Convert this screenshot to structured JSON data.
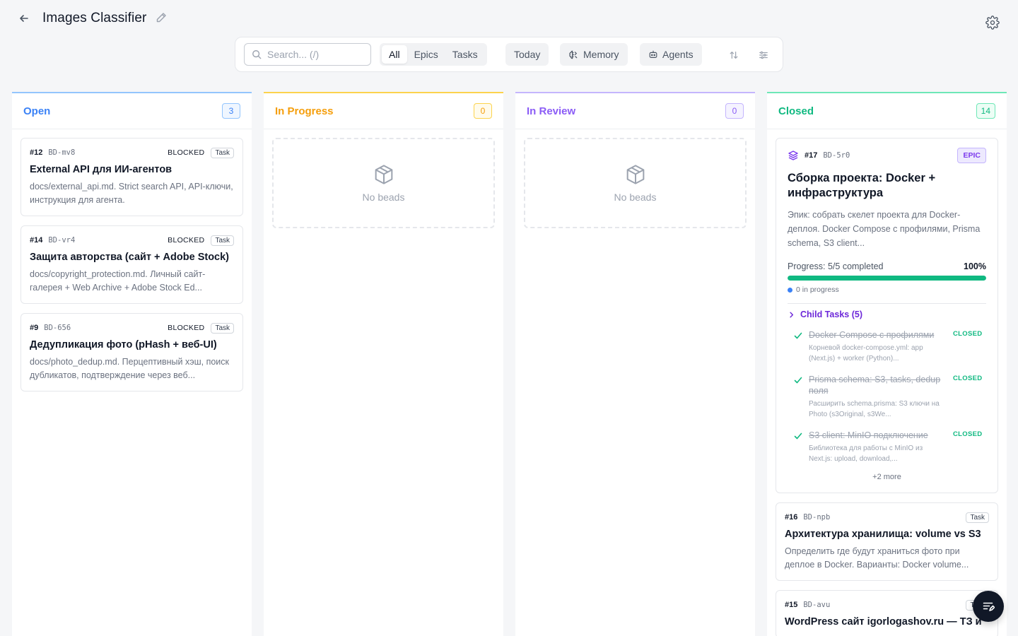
{
  "header": {
    "title": "Images Classifier",
    "back_icon": "arrow-left-icon",
    "edit_icon": "pencil-icon",
    "settings_icon": "gear-icon"
  },
  "toolbar": {
    "search_placeholder": "Search... (/)",
    "filters": [
      "All",
      "Epics",
      "Tasks"
    ],
    "active_filter": "All",
    "today_label": "Today",
    "memory_label": "Memory",
    "agents_label": "Agents",
    "sort_icon": "sort-arrows-icon",
    "settings_icon": "sliders-icon"
  },
  "columns": [
    {
      "title": "Open",
      "count": "3",
      "color": "#3b82f6"
    },
    {
      "title": "In Progress",
      "count": "0",
      "color": "#f59e0b",
      "empty_text": "No beads"
    },
    {
      "title": "In Review",
      "count": "0",
      "color": "#8b5cf6",
      "empty_text": "No beads"
    },
    {
      "title": "Closed",
      "count": "14",
      "color": "#10b981"
    }
  ],
  "open_cards": [
    {
      "num": "#12",
      "code": "BD-mv8",
      "status": "BLOCKED",
      "type": "Task",
      "title": "External API для ИИ-агентов",
      "desc": "docs/external_api.md. Strict search API, API-ключи, инструкция для агента."
    },
    {
      "num": "#14",
      "code": "BD-vr4",
      "status": "BLOCKED",
      "type": "Task",
      "title": "Защита авторства (сайт + Adobe Stock)",
      "desc": "docs/copyright_protection.md. Личный сайт-галерея + Web Archive + Adobe Stock Ed..."
    },
    {
      "num": "#9",
      "code": "BD-656",
      "status": "BLOCKED",
      "type": "Task",
      "title": "Дедупликация фото (pHash + веб-UI)",
      "desc": "docs/photo_dedup.md. Перцептивный хэш, поиск дубликатов, подтверждение через веб..."
    }
  ],
  "epic": {
    "num": "#17",
    "code": "BD-5r0",
    "badge": "EPIC",
    "title": "Сборка проекта: Docker + инфраструктура",
    "desc": "Эпик: собрать скелет проекта для Docker-деплоя. Docker Compose с профилями, Prisma schema, S3 client...",
    "progress_label": "Progress: 5/5 completed",
    "progress_pct": "100%",
    "progress_value": 1.0,
    "in_progress_text": "0 in progress",
    "children_label": "Child Tasks (5)",
    "children": [
      {
        "title": "Docker Compose с профилями",
        "desc": "Корневой docker-compose.yml: app (Next.js) + worker (Python)...",
        "status": "CLOSED"
      },
      {
        "title": "Prisma schema: S3, tasks, dedup поля",
        "desc": "Расширить schema.prisma: S3 ключи на Photo (s3Original, s3We...",
        "status": "CLOSED"
      },
      {
        "title": "S3 client: MinIO подключение",
        "desc": "Библиотека для работы с MinIO из Next.js: upload, download,...",
        "status": "CLOSED"
      }
    ],
    "more_label": "+2 more"
  },
  "closed_cards": [
    {
      "num": "#16",
      "code": "BD-npb",
      "type": "Task",
      "title": "Архитектура хранилища: volume vs S3",
      "desc": "Определить где будут храниться фото при деплое в Docker. Варианты: Docker volume..."
    },
    {
      "num": "#15",
      "code": "BD-avu",
      "type": "Task",
      "title": "WordPress сайт igorlogashov.ru — ТЗ и"
    }
  ],
  "fab_icon": "list-edit-icon"
}
